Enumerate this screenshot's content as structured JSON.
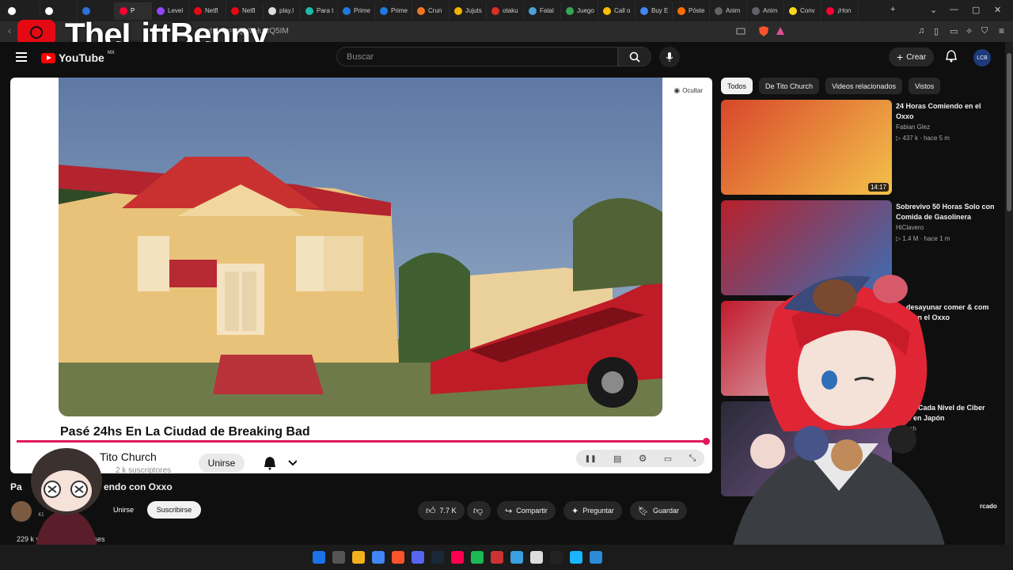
{
  "browser": {
    "tabs": [
      {
        "label": "",
        "color": "#ffffff"
      },
      {
        "label": "",
        "color": "#ffffff"
      },
      {
        "label": "",
        "color": "#2f6fe0"
      },
      {
        "label": "P",
        "color": "#ff0033",
        "active": true
      },
      {
        "label": "Level",
        "color": "#9146ff"
      },
      {
        "label": "Netfl",
        "color": "#e50914"
      },
      {
        "label": "Netfl",
        "color": "#e50914"
      },
      {
        "label": "play.l",
        "color": "#dddddd"
      },
      {
        "label": "Para t",
        "color": "#1db9ad"
      },
      {
        "label": "Prime",
        "color": "#1f7ae0"
      },
      {
        "label": "Prime",
        "color": "#1f7ae0"
      },
      {
        "label": "Crun",
        "color": "#f47521"
      },
      {
        "label": "Jujuts",
        "color": "#f0b400"
      },
      {
        "label": "otaku",
        "color": "#d93025"
      },
      {
        "label": "Fatal",
        "color": "#4aa3d6"
      },
      {
        "label": "Juego",
        "color": "#34a853"
      },
      {
        "label": "Call o",
        "color": "#fbbc05"
      },
      {
        "label": "Buy E",
        "color": "#4285f4"
      },
      {
        "label": "Póste",
        "color": "#ff6d00"
      },
      {
        "label": "Anim",
        "color": "#5f6368"
      },
      {
        "label": "Anim",
        "color": "#5f6368"
      },
      {
        "label": "Conv",
        "color": "#f9d71c"
      },
      {
        "label": "¡Hon",
        "color": "#ff0033"
      }
    ],
    "url": "atch?v=yQbVHuwQ5IM"
  },
  "overlay": {
    "streamer_name": "TheLittBenny"
  },
  "header": {
    "logo_text": "YouTube",
    "region": "MX",
    "search_placeholder": "Buscar",
    "create_label": "Crear",
    "avatar_text": "LCB"
  },
  "player": {
    "hide_label": "Ocultar",
    "embedded_title": "Pasé 24hs En La Ciudad de Breaking Bad",
    "channel": "Tito Church",
    "subs": "2 k suscriptores",
    "join_label": "Unirse"
  },
  "video": {
    "title_start": "Pa",
    "title_end": "endo con Oxxo",
    "channel_subs": "41",
    "join_label": "Unirse",
    "subscribe_label": "Suscribirse",
    "likes": "7.7 K",
    "share_label": "Compartir",
    "ask_label": "Preguntar",
    "save_label": "Guardar",
    "views": "229 k vis",
    "age": "meses"
  },
  "sidebar": {
    "chips": [
      "Todos",
      "De Tito Church",
      "Videos relacionados",
      "Vistos"
    ],
    "recommendations": [
      {
        "title": "24 Horas Comiendo en el Oxxo",
        "channel": "Fabian Glez",
        "meta": "▷ 437 k · hace 5 m",
        "duration": "14:17"
      },
      {
        "title": "Sobrevivo 50 Horas Solo con Comida de Gasolinera",
        "channel": "HiClavero",
        "meta": "▷ 1.4 M · hace 1 m",
        "duration": ""
      },
      {
        "title": "de desayunar comer & com $100 en el Oxxo",
        "channel": "",
        "meta": "ce 3 días",
        "duration": ""
      },
      {
        "title": "Probé Cada Nivel de Ciber Café en Japón",
        "channel": "Church",
        "meta": "e 2 m",
        "duration": ""
      }
    ],
    "last_partial": "rcado"
  },
  "colors": {
    "accent": "#e0195a",
    "yt_red": "#ff0000"
  }
}
